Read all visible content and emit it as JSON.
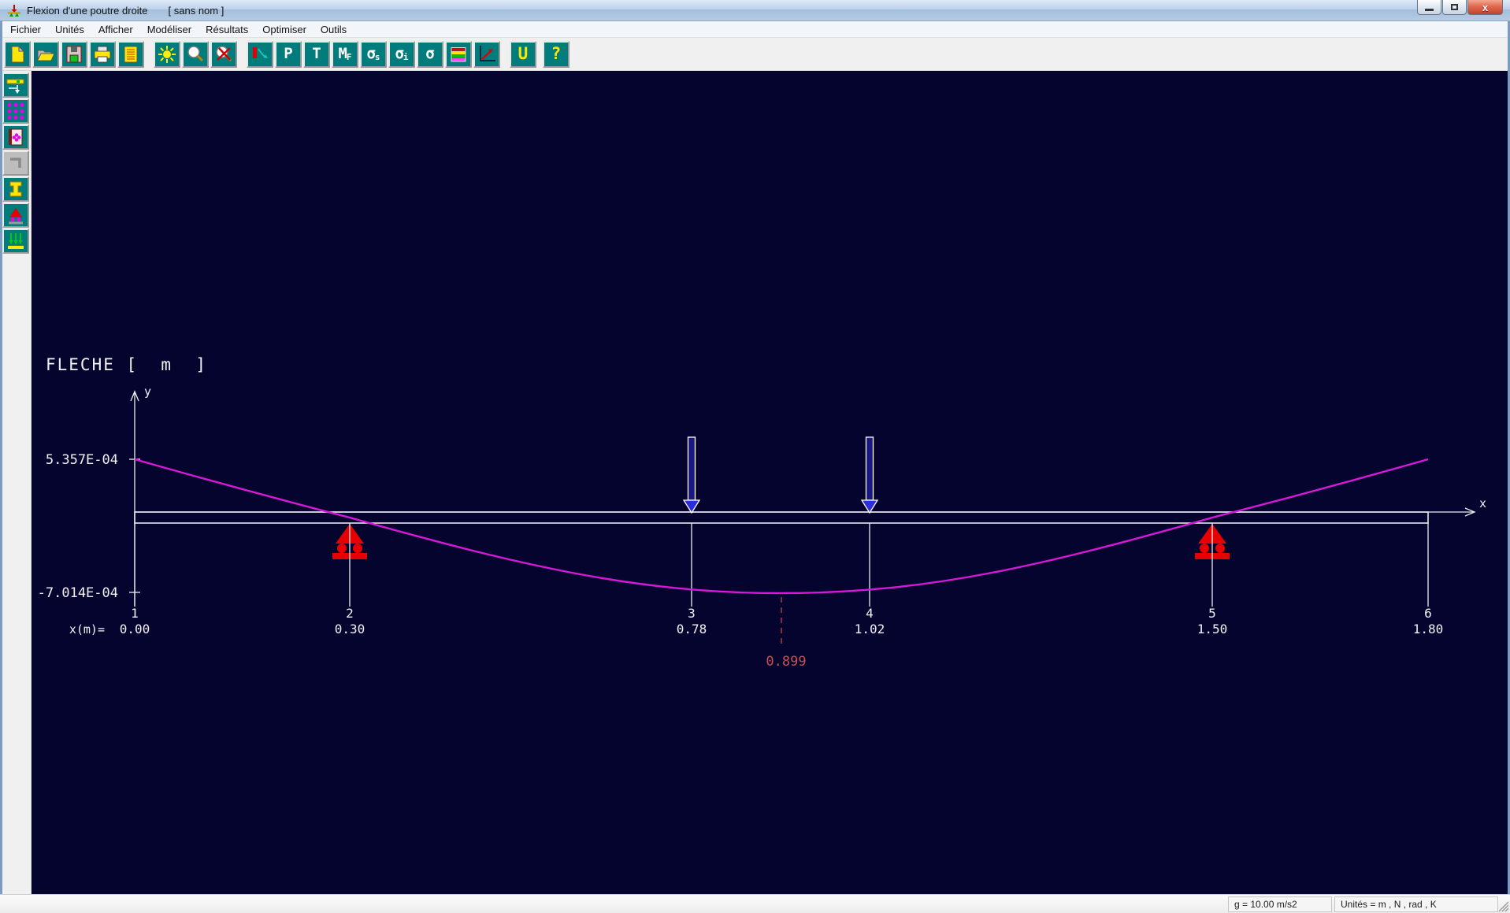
{
  "window": {
    "title": "Flexion d'une poutre droite",
    "document_label": "[ sans nom ]",
    "close_glyph": "x"
  },
  "menu": {
    "items": [
      "Fichier",
      "Unités",
      "Afficher",
      "Modéliser",
      "Résultats",
      "Optimiser",
      "Outils"
    ]
  },
  "toolbar": {
    "p_label": "P",
    "t_label": "T",
    "m_label": "M",
    "m_sub": "F",
    "sigma_label": "σ",
    "sigma_sup_sub": "s",
    "sigma_inf_sub": "i",
    "units_label": "U",
    "help_label": "?"
  },
  "plot": {
    "title": "FLECHE [  m  ]",
    "y_axis_label": "y",
    "x_axis_label": "x",
    "y_upper": "5.357E-04",
    "y_lower": "-7.014E-04",
    "x_row_prefix": "x(m)=",
    "nodes": [
      {
        "num": "1",
        "x": "0.00"
      },
      {
        "num": "2",
        "x": "0.30"
      },
      {
        "num": "3",
        "x": "0.78"
      },
      {
        "num": "4",
        "x": "1.02"
      },
      {
        "num": "5",
        "x": "1.50"
      },
      {
        "num": "6",
        "x": "1.80"
      }
    ],
    "extremum_label": "0.899",
    "colors": {
      "canvas": "#04042f",
      "curve": "#d818d8",
      "support": "#e80000",
      "load": "#2d2de0",
      "marker": "#a83838"
    }
  },
  "status_bar": {
    "gravity": "g = 10.00 m/s2",
    "units": "Unités = m , N , rad , K"
  },
  "chart_data": {
    "type": "line",
    "title": "FLECHE [ m ]",
    "xlabel": "x",
    "ylabel": "y",
    "x_units": "m",
    "y_units": "m",
    "series": [
      {
        "name": "fleche",
        "x": [
          0.0,
          0.3,
          0.899,
          1.5,
          1.8
        ],
        "y": [
          0.0005357,
          0.0,
          -0.0007014,
          0.0,
          0.0005357
        ]
      }
    ],
    "y_max": 0.0005357,
    "y_min": -0.0007014,
    "x_at_min": 0.899,
    "node_x": [
      0.0,
      0.3,
      0.78,
      1.02,
      1.5,
      1.8
    ],
    "supports_x": [
      0.3,
      1.5
    ],
    "point_loads_x": [
      0.78,
      1.02
    ],
    "legend": "none",
    "grid": false,
    "background": "dark-navy"
  }
}
